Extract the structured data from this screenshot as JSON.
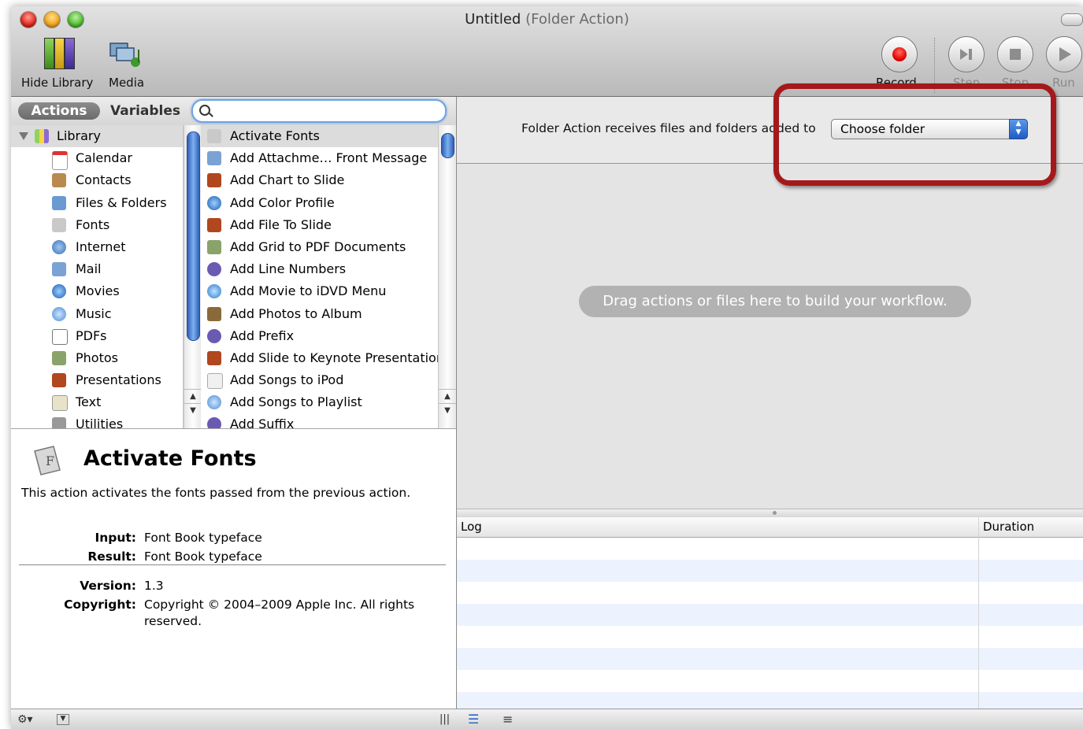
{
  "window": {
    "title": "Untitled",
    "title_sub": "(Folder Action)"
  },
  "toolbar": {
    "hide_library": "Hide Library",
    "media": "Media",
    "record": "Record",
    "step": "Step",
    "stop": "Stop",
    "run": "Run"
  },
  "left_tabs": {
    "actions": "Actions",
    "variables": "Variables"
  },
  "search": {
    "value": "",
    "placeholder": ""
  },
  "library": {
    "root": "Library",
    "items": [
      "Calendar",
      "Contacts",
      "Files & Folders",
      "Fonts",
      "Internet",
      "Mail",
      "Movies",
      "Music",
      "PDFs",
      "Photos",
      "Presentations",
      "Text",
      "Utilities"
    ]
  },
  "actions": {
    "selected": "Activate Fonts",
    "items": [
      "Activate Fonts",
      "Add Attachme… Front Message",
      "Add Chart to Slide",
      "Add Color Profile",
      "Add File To Slide",
      "Add Grid to PDF Documents",
      "Add Line Numbers",
      "Add Movie to iDVD Menu",
      "Add Photos to Album",
      "Add Prefix",
      "Add Slide to Keynote Presentation",
      "Add Songs to iPod",
      "Add Songs to Playlist",
      "Add Suffix"
    ]
  },
  "description": {
    "title": "Activate Fonts",
    "text": "This action activates the fonts passed from the previous action.",
    "input_label": "Input:",
    "input_value": "Font Book typeface",
    "result_label": "Result:",
    "result_value": "Font Book typeface",
    "version_label": "Version:",
    "version_value": "1.3",
    "copyright_label": "Copyright:",
    "copyright_line1": "Copyright © 2004–2009 Apple Inc. All rights",
    "copyright_line2": "reserved."
  },
  "folder_action": {
    "label": "Folder Action receives files and folders added to",
    "popup_value": "Choose folder"
  },
  "workflow": {
    "hint": "Drag actions or files here to build your workflow."
  },
  "log": {
    "col_log": "Log",
    "col_duration": "Duration"
  },
  "colors": {
    "accent": "#6ea3e2",
    "highlight_box": "#a4191b",
    "record": "#e00000"
  }
}
